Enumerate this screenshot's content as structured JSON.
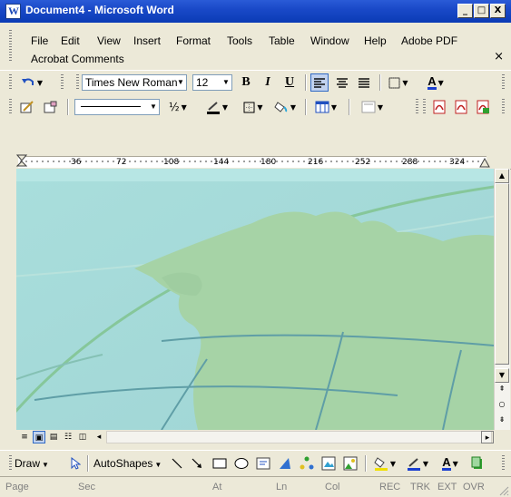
{
  "window": {
    "title": "Document4 - Microsoft Word",
    "minimize": "_",
    "maximize": "□",
    "close": "X"
  },
  "menu": {
    "items": [
      "File",
      "Edit",
      "View",
      "Insert",
      "Format",
      "Tools",
      "Table",
      "Window",
      "Help",
      "Adobe PDF"
    ],
    "row2": [
      "Acrobat Comments"
    ],
    "close_doc": "×"
  },
  "formatting": {
    "font": "Times New Roman",
    "size": "12",
    "bold": "B",
    "italic": "I",
    "underline": "U",
    "font_color_label": "A"
  },
  "tables_borders": {
    "line_weight": "½"
  },
  "ruler": {
    "ticks": [
      "36",
      "72",
      "108",
      "144",
      "180",
      "216",
      "252",
      "288",
      "324"
    ]
  },
  "drawing": {
    "draw": "Draw",
    "autoshapes": "AutoShapes",
    "font_color_label": "A"
  },
  "status": {
    "page": "Page",
    "sec": "Sec",
    "at": "At",
    "ln": "Ln",
    "col": "Col",
    "rec": "REC",
    "trk": "TRK",
    "ext": "EXT",
    "ovr": "OVR"
  },
  "colors": {
    "title_bar": "#0b3bb5",
    "chrome": "#ece9d8",
    "doc_sky": "#a8dede",
    "land": "#a8d4a8"
  }
}
